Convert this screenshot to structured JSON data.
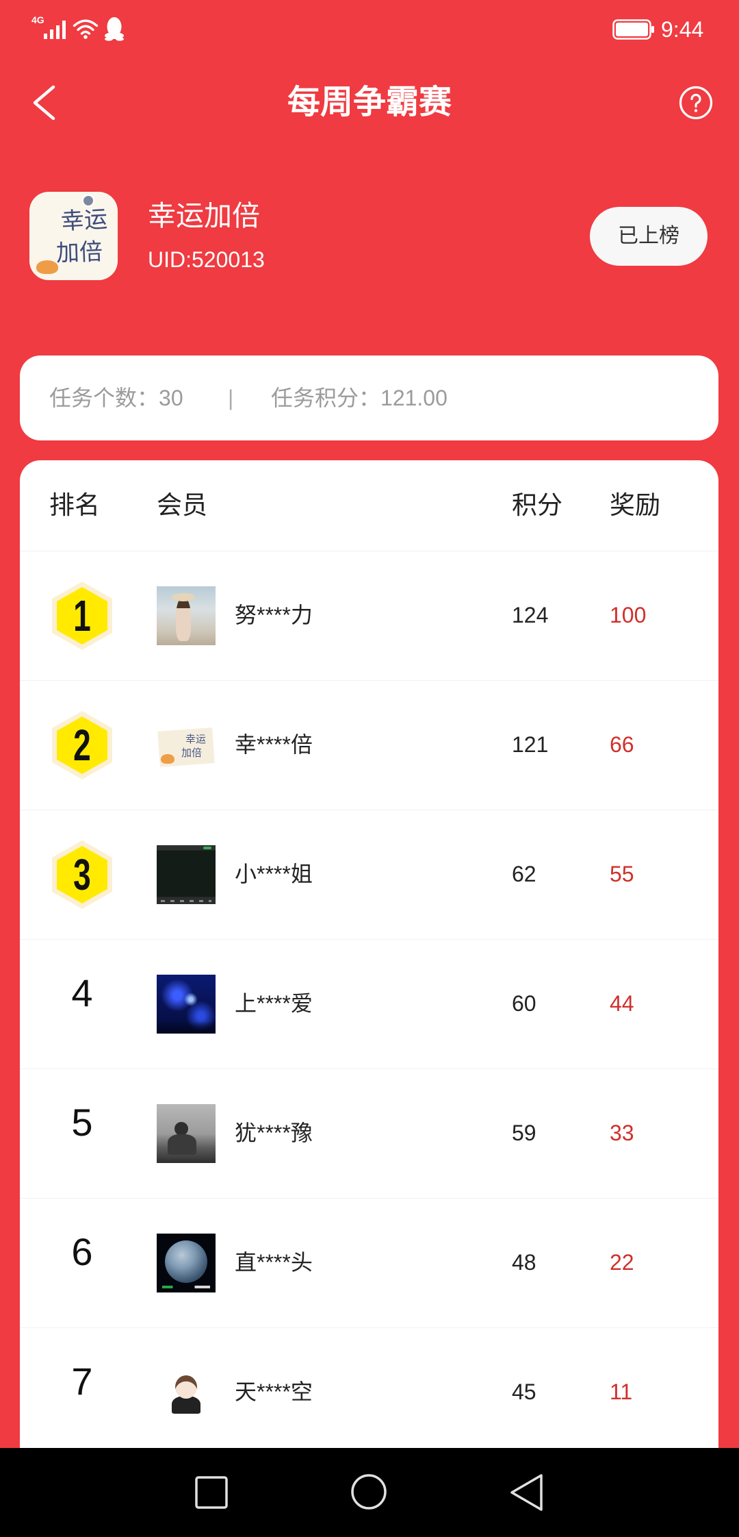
{
  "status_bar": {
    "network": "4G",
    "time": "9:44",
    "icons": [
      "signal-icon",
      "wifi-icon",
      "qq-icon",
      "battery-icon"
    ]
  },
  "header": {
    "title": "每周争霸赛",
    "back_icon": "chevron-left-icon",
    "help_icon": "question-circle-icon"
  },
  "profile": {
    "avatar_lines": [
      "幸运",
      "加倍"
    ],
    "name": "幸运加倍",
    "uid": "UID:520013",
    "status_button": "已上榜"
  },
  "stats": {
    "task_count_label": "任务个数：",
    "task_count": "30",
    "separator": "|",
    "task_points_label": "任务积分：",
    "task_points": "121.00"
  },
  "leaderboard": {
    "headers": {
      "rank": "排名",
      "member": "会员",
      "score": "积分",
      "reward": "奖励"
    },
    "rows": [
      {
        "rank": "1",
        "name": "努****力",
        "score": "124",
        "reward": "100"
      },
      {
        "rank": "2",
        "name": "幸****倍",
        "score": "121",
        "reward": "66"
      },
      {
        "rank": "3",
        "name": "小****姐",
        "score": "62",
        "reward": "55"
      },
      {
        "rank": "4",
        "name": "上****爱",
        "score": "60",
        "reward": "44"
      },
      {
        "rank": "5",
        "name": "犹****豫",
        "score": "59",
        "reward": "33"
      },
      {
        "rank": "6",
        "name": "直****头",
        "score": "48",
        "reward": "22"
      },
      {
        "rank": "7",
        "name": "天****空",
        "score": "45",
        "reward": "11"
      }
    ]
  },
  "nav_bar": {
    "icons": [
      "recent-apps-icon",
      "home-icon",
      "back-icon"
    ]
  },
  "colors": {
    "background_red": "#EF3B41",
    "reward_red": "#D0302B",
    "badge_yellow": "#FFEA00",
    "badge_ring": "#FCF0D3",
    "card_white": "#FFFFFF",
    "muted_gray": "#9B9B9B"
  }
}
